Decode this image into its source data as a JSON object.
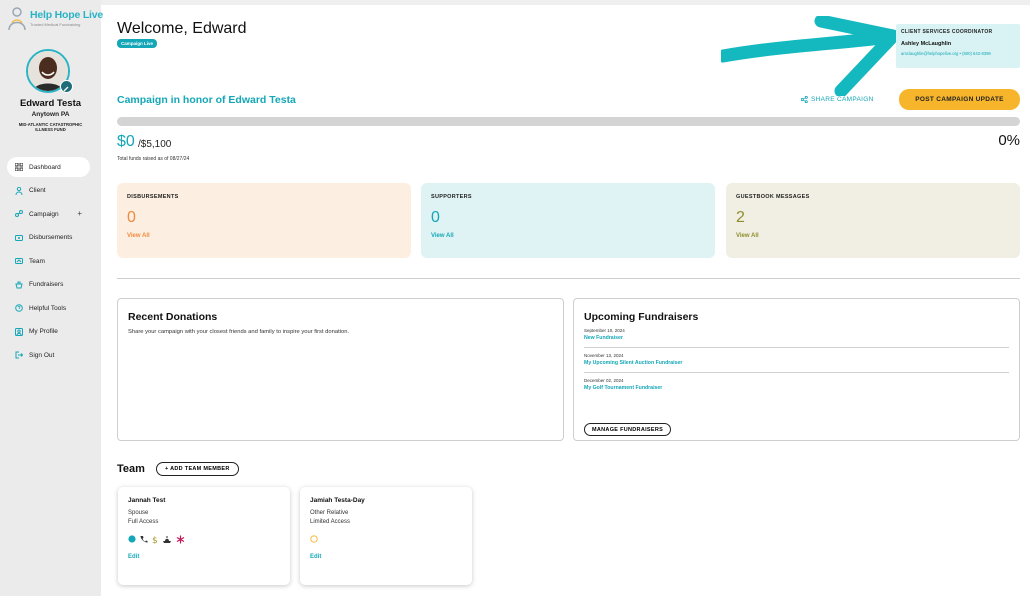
{
  "brand": {
    "name": "Help Hope Live",
    "tagline": "Trusted Medical Fundraising"
  },
  "user": {
    "name": "Edward Testa",
    "location": "Anytown PA",
    "fund": "MID-ATLANTIC CATASTROPHIC ILLNESS FUND"
  },
  "nav": [
    {
      "label": "Dashboard",
      "icon": "dashboard-icon",
      "active": true
    },
    {
      "label": "Client",
      "icon": "client-icon"
    },
    {
      "label": "Campaign",
      "icon": "campaign-icon",
      "expand": "+"
    },
    {
      "label": "Disbursements",
      "icon": "disbursements-icon"
    },
    {
      "label": "Team",
      "icon": "team-icon"
    },
    {
      "label": "Fundraisers",
      "icon": "fundraisers-icon"
    },
    {
      "label": "Helpful Tools",
      "icon": "helpful-tools-icon"
    },
    {
      "label": "My Profile",
      "icon": "profile-icon"
    },
    {
      "label": "Sign Out",
      "icon": "sign-out-icon"
    }
  ],
  "header": {
    "welcome": "Welcome, Edward",
    "status": "Campaign Live"
  },
  "coordinator": {
    "heading": "CLIENT SERVICES COORDINATOR",
    "name": "Ashley McLaughlin",
    "contact": "amclaughlin@helphopelive.org • (800) 642-8399"
  },
  "campaign": {
    "title": "Campaign in honor of Edward Testa",
    "share_label": "SHARE CAMPAIGN",
    "post_label": "POST CAMPAIGN UPDATE",
    "raised": "$0",
    "goal": "/$5,100",
    "raised_note": "Total funds raised as of 08/27/24",
    "percent": "0%",
    "progress_fraction": 0
  },
  "stats": [
    {
      "heading": "DISBURSEMENTS",
      "value": "0",
      "link": "View All"
    },
    {
      "heading": "SUPPORTERS",
      "value": "0",
      "link": "View All"
    },
    {
      "heading": "GUESTBOOK MESSAGES",
      "value": "2",
      "link": "View All"
    }
  ],
  "donations": {
    "title": "Recent Donations",
    "text": "Share your campaign with your closest friends and family to inspire your first donation."
  },
  "fundraisers": {
    "title": "Upcoming Fundraisers",
    "items": [
      {
        "date": "September 10, 2024",
        "name": "New Fundraiser"
      },
      {
        "date": "November 13, 2024",
        "name": "My Upcoming Silent Auction Fundraiser"
      },
      {
        "date": "December 02, 2024",
        "name": "My Golf Tournament Fundraiser"
      }
    ],
    "manage_label": "MANAGE FUNDRAISERS"
  },
  "team": {
    "title": "Team",
    "add_label": "+ ADD TEAM MEMBER",
    "members": [
      {
        "name": "Jannah Test",
        "relation": "Spouse",
        "access": "Full Access",
        "edit": "Edit"
      },
      {
        "name": "Jamiah Testa-Day",
        "relation": "Other Relative",
        "access": "Limited Access",
        "edit": "Edit"
      }
    ]
  },
  "colors": {
    "teal": "#14a7b7",
    "orange": "#f08a3c",
    "olive": "#8e8d2a",
    "yellow": "#f7b52c"
  }
}
